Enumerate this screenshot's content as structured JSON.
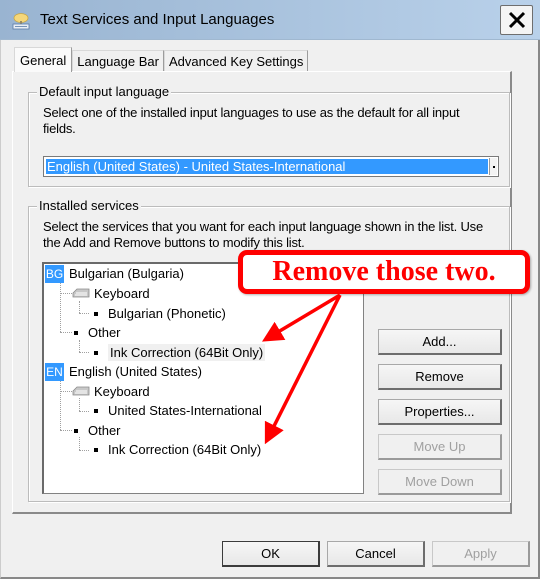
{
  "window": {
    "title": "Text Services and Input Languages",
    "close_label": "close"
  },
  "tabs": [
    {
      "label": "General",
      "active": true
    },
    {
      "label": "Language Bar",
      "active": false
    },
    {
      "label": "Advanced Key Settings",
      "active": false
    }
  ],
  "default_input": {
    "legend": "Default input language",
    "description_line1": "Select one of the installed input languages to use as the default for all input",
    "description_line2": "fields.",
    "selected_value": "English (United States) - United States-International"
  },
  "installed_services": {
    "legend": "Installed services",
    "description_line1": "Select the services that you want for each input language shown in the list. Use",
    "description_line2": "the Add and Remove buttons to modify this list.",
    "tree": {
      "languages": [
        {
          "badge": "BG",
          "name": "Bulgarian (Bulgaria)",
          "keyboard_label": "Keyboard",
          "keyboard_item": "Bulgarian (Phonetic)",
          "other_label": "Other",
          "other_item": "Ink Correction (64Bit Only)"
        },
        {
          "badge": "EN",
          "name": "English (United States)",
          "keyboard_label": "Keyboard",
          "keyboard_item": "United States-International",
          "other_label": "Other",
          "other_item": "Ink Correction (64Bit Only)"
        }
      ]
    },
    "buttons": {
      "add": "Add...",
      "remove": "Remove",
      "properties": "Properties...",
      "move_up": "Move Up",
      "move_down": "Move Down"
    }
  },
  "footer": {
    "ok": "OK",
    "cancel": "Cancel",
    "apply": "Apply"
  },
  "annotation": {
    "callout_text": "Remove those two.",
    "color": "#ff0000"
  }
}
